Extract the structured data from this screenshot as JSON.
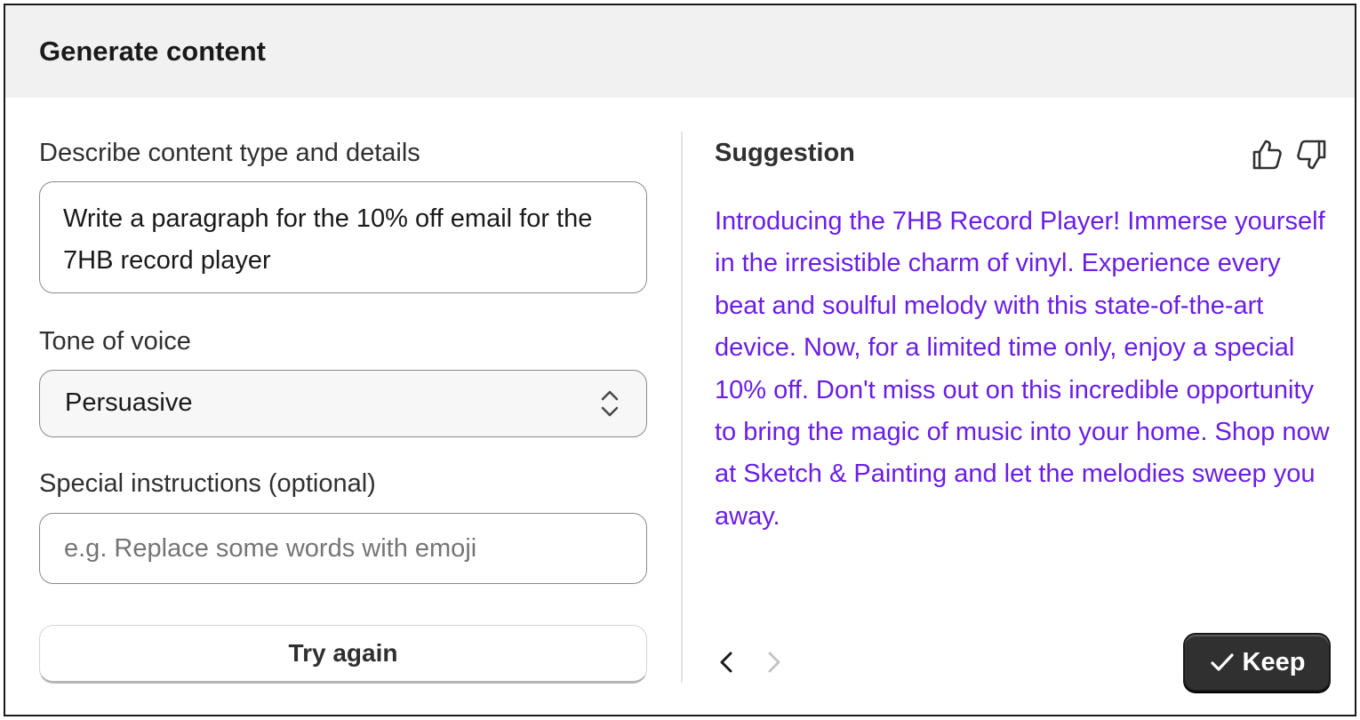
{
  "header": {
    "title": "Generate content"
  },
  "form": {
    "description_label": "Describe content type and details",
    "description_value": "Write a paragraph for the 10% off email for the 7HB record player",
    "tone_label": "Tone of voice",
    "tone_value": "Persuasive",
    "special_label": "Special instructions (optional)",
    "special_placeholder": "e.g. Replace some words with emoji",
    "special_value": "",
    "try_again_label": "Try again"
  },
  "suggestion": {
    "title": "Suggestion",
    "text": "Introducing the 7HB Record Player! Immerse yourself in the irresistible charm of vinyl. Experience every beat and soulful melody with this state-of-the-art device. Now, for a limited time only, enjoy a special 10% off. Don't miss out on this incredible opportunity to bring the magic of music into your home. Shop now at Sketch & Painting and let the melodies sweep you away.",
    "text_color": "#6a1ee6",
    "keep_label": "Keep",
    "icons": {
      "feedback_positive": "thumbs-up-icon",
      "feedback_negative": "thumbs-down-icon",
      "previous": "chevron-left-icon",
      "next": "chevron-right-icon",
      "confirm": "checkmark-icon"
    }
  }
}
